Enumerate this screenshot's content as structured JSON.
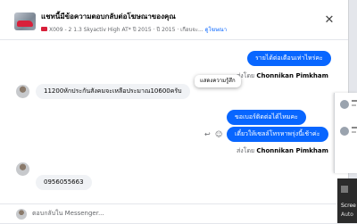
{
  "header": {
    "title": "แชทนี้มีข้อความตอบกลับต่อโฆษณาของคุณ",
    "subtitle": "X009 - 2 1.3 Skyactiv High AT* ปี 2015",
    "subtitle_year": "ปี 2015",
    "subtitle_more": "เกือบจะ...",
    "subtitle_link": "ดูโฆษณา",
    "close_icon": "close-icon"
  },
  "messages": {
    "out1": "รายได้ต่อเดือนเท่าไหร่คะ",
    "sent1_prefix": "ส่งโดย",
    "sent1_name": "Chonnikan Pimkham",
    "in1": "11200หักประกันสังคมจะเหลือประมาณ10600ครับ",
    "out2": "ขอเบอร์ติดต่อได้ไหมคะ",
    "out3": "เดี๋ยวให้เซลล์โทรหาพรุ่งนี้เช้าค่ะ",
    "tooltip": "แสดงความรู้สึก",
    "sent2_prefix": "ส่งโดย",
    "sent2_name": "Chonnikan Pimkham",
    "in2": "0956055663"
  },
  "composer": {
    "placeholder": "ตอบกลับใน Messenger..."
  },
  "notification": {
    "line1": "Scree",
    "line2": "Auto"
  }
}
